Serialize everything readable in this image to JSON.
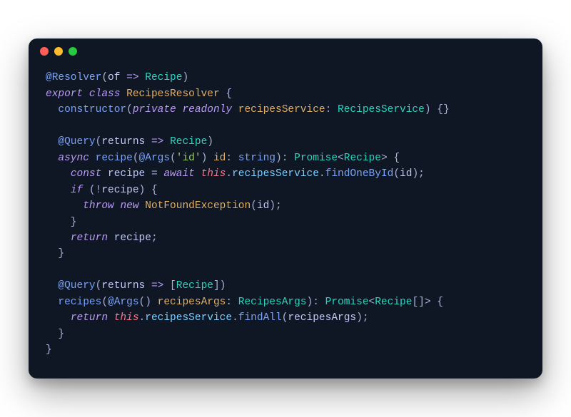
{
  "titlebar": {
    "close": "close",
    "minimize": "minimize",
    "zoom": "zoom"
  },
  "code": {
    "lines": [
      [
        [
          "decorator",
          "@Resolver"
        ],
        [
          "punct",
          "("
        ],
        [
          "ident",
          "of"
        ],
        [
          "punct",
          " "
        ],
        [
          "arrow",
          "=>"
        ],
        [
          "punct",
          " "
        ],
        [
          "type",
          "Recipe"
        ],
        [
          "punct",
          ")"
        ]
      ],
      [
        [
          "keyword",
          "export"
        ],
        [
          "punct",
          " "
        ],
        [
          "keyword",
          "class"
        ],
        [
          "punct",
          " "
        ],
        [
          "class-name",
          "RecipesResolver"
        ],
        [
          "punct",
          " {"
        ]
      ],
      [
        [
          "punct",
          "  "
        ],
        [
          "method",
          "constructor"
        ],
        [
          "punct",
          "("
        ],
        [
          "keyword",
          "private"
        ],
        [
          "punct",
          " "
        ],
        [
          "keyword",
          "readonly"
        ],
        [
          "punct",
          " "
        ],
        [
          "param",
          "recipesService"
        ],
        [
          "punct",
          ": "
        ],
        [
          "type",
          "RecipesService"
        ],
        [
          "punct",
          ") {}"
        ]
      ],
      [
        [
          "punct",
          ""
        ]
      ],
      [
        [
          "punct",
          "  "
        ],
        [
          "decorator",
          "@Query"
        ],
        [
          "punct",
          "("
        ],
        [
          "ident",
          "returns"
        ],
        [
          "punct",
          " "
        ],
        [
          "arrow",
          "=>"
        ],
        [
          "punct",
          " "
        ],
        [
          "type",
          "Recipe"
        ],
        [
          "punct",
          ")"
        ]
      ],
      [
        [
          "punct",
          "  "
        ],
        [
          "keyword",
          "async"
        ],
        [
          "punct",
          " "
        ],
        [
          "method",
          "recipe"
        ],
        [
          "punct",
          "("
        ],
        [
          "decorator",
          "@Args"
        ],
        [
          "punct",
          "("
        ],
        [
          "string",
          "'id'"
        ],
        [
          "punct",
          ") "
        ],
        [
          "param",
          "id"
        ],
        [
          "punct",
          ": "
        ],
        [
          "builtin",
          "string"
        ],
        [
          "punct",
          "): "
        ],
        [
          "type",
          "Promise"
        ],
        [
          "punct",
          "<"
        ],
        [
          "type",
          "Recipe"
        ],
        [
          "punct",
          "> {"
        ]
      ],
      [
        [
          "punct",
          "    "
        ],
        [
          "keyword",
          "const"
        ],
        [
          "punct",
          " "
        ],
        [
          "ident",
          "recipe"
        ],
        [
          "punct",
          " = "
        ],
        [
          "keyword",
          "await"
        ],
        [
          "punct",
          " "
        ],
        [
          "this",
          "this"
        ],
        [
          "punct",
          "."
        ],
        [
          "prop",
          "recipesService"
        ],
        [
          "punct",
          "."
        ],
        [
          "method",
          "findOneById"
        ],
        [
          "punct",
          "("
        ],
        [
          "ident",
          "id"
        ],
        [
          "punct",
          ");"
        ]
      ],
      [
        [
          "punct",
          "    "
        ],
        [
          "keyword",
          "if"
        ],
        [
          "punct",
          " (!"
        ],
        [
          "ident",
          "recipe"
        ],
        [
          "punct",
          ") {"
        ]
      ],
      [
        [
          "punct",
          "      "
        ],
        [
          "keyword",
          "throw"
        ],
        [
          "punct",
          " "
        ],
        [
          "keyword",
          "new"
        ],
        [
          "punct",
          " "
        ],
        [
          "class-name",
          "NotFoundException"
        ],
        [
          "punct",
          "("
        ],
        [
          "ident",
          "id"
        ],
        [
          "punct",
          ");"
        ]
      ],
      [
        [
          "punct",
          "    }"
        ]
      ],
      [
        [
          "punct",
          "    "
        ],
        [
          "keyword",
          "return"
        ],
        [
          "punct",
          " "
        ],
        [
          "ident",
          "recipe"
        ],
        [
          "punct",
          ";"
        ]
      ],
      [
        [
          "punct",
          "  }"
        ]
      ],
      [
        [
          "punct",
          ""
        ]
      ],
      [
        [
          "punct",
          "  "
        ],
        [
          "decorator",
          "@Query"
        ],
        [
          "punct",
          "("
        ],
        [
          "ident",
          "returns"
        ],
        [
          "punct",
          " "
        ],
        [
          "arrow",
          "=>"
        ],
        [
          "punct",
          " ["
        ],
        [
          "type",
          "Recipe"
        ],
        [
          "punct",
          "])"
        ]
      ],
      [
        [
          "punct",
          "  "
        ],
        [
          "method",
          "recipes"
        ],
        [
          "punct",
          "("
        ],
        [
          "decorator",
          "@Args"
        ],
        [
          "punct",
          "() "
        ],
        [
          "param",
          "recipesArgs"
        ],
        [
          "punct",
          ": "
        ],
        [
          "type",
          "RecipesArgs"
        ],
        [
          "punct",
          "): "
        ],
        [
          "type",
          "Promise"
        ],
        [
          "punct",
          "<"
        ],
        [
          "type",
          "Recipe"
        ],
        [
          "punct",
          "[]> {"
        ]
      ],
      [
        [
          "punct",
          "    "
        ],
        [
          "keyword",
          "return"
        ],
        [
          "punct",
          " "
        ],
        [
          "this",
          "this"
        ],
        [
          "punct",
          "."
        ],
        [
          "prop",
          "recipesService"
        ],
        [
          "punct",
          "."
        ],
        [
          "method",
          "findAll"
        ],
        [
          "punct",
          "("
        ],
        [
          "ident",
          "recipesArgs"
        ],
        [
          "punct",
          ");"
        ]
      ],
      [
        [
          "punct",
          "  }"
        ]
      ],
      [
        [
          "punct",
          "}"
        ]
      ]
    ]
  }
}
